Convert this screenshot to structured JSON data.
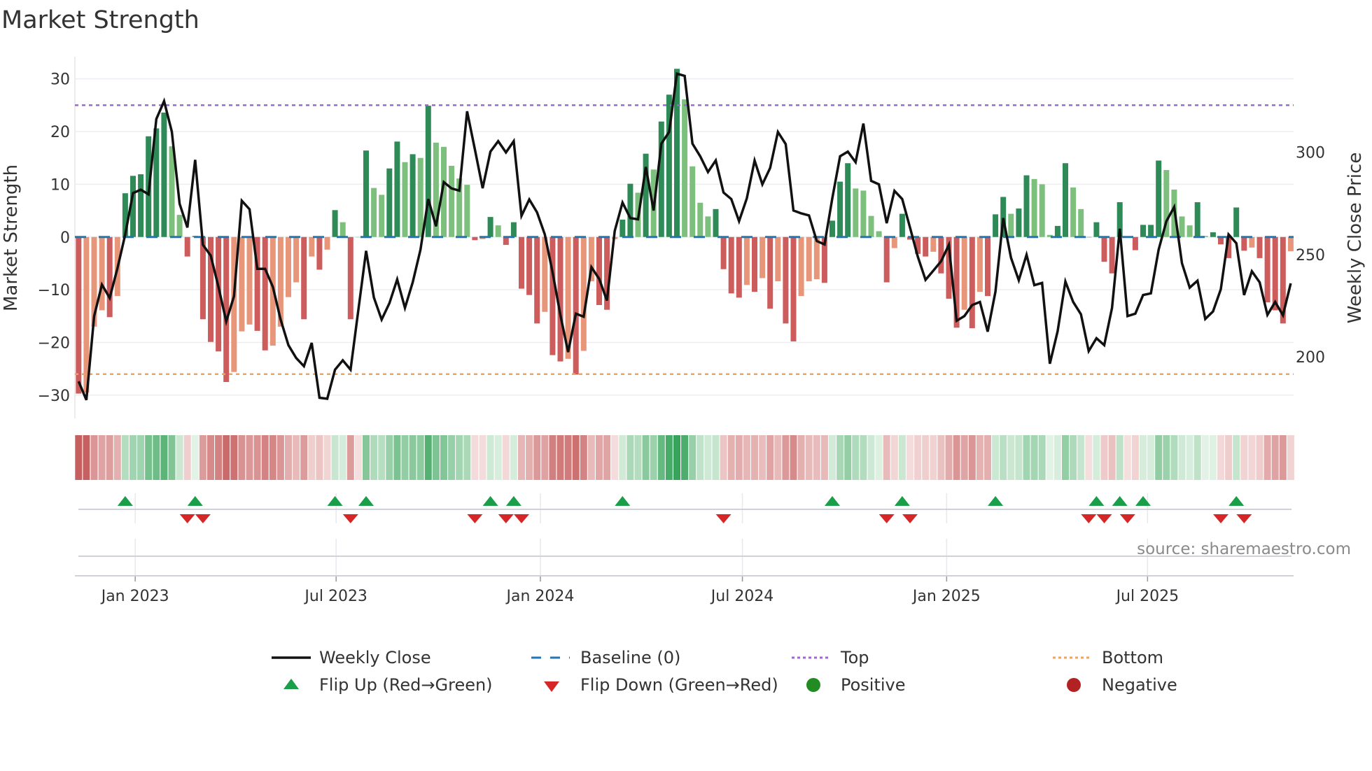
{
  "title": "Market Strength",
  "source": "source: sharemaestro.com",
  "legend": {
    "weekly_close": "Weekly Close",
    "baseline": "Baseline (0)",
    "top": "Top",
    "bottom": "Bottom",
    "flip_up": "Flip Up (Red→Green)",
    "flip_down": "Flip Down (Green→Red)",
    "positive": "Positive",
    "negative": "Negative"
  },
  "chart_data": {
    "type": "bar+line",
    "title": "Market Strength",
    "ylabel": "Market Strength",
    "y2label": "Weekly Close Price",
    "ylim": [
      -34.4,
      34.2
    ],
    "y2lim": [
      169.9,
      346.7
    ],
    "yticks": [
      -30,
      -20,
      -10,
      0,
      10,
      20,
      30
    ],
    "ytick_labels": [
      "−30",
      "−20",
      "−10",
      "0",
      "10",
      "20",
      "30"
    ],
    "y2ticks": [
      200,
      250,
      300
    ],
    "y2tick_labels": [
      "200",
      "250",
      "300"
    ],
    "xticks": [
      {
        "date": "2023-01-01",
        "label": "Jan 2023"
      },
      {
        "date": "2023-07-01",
        "label": "Jul 2023"
      },
      {
        "date": "2024-01-01",
        "label": "Jan 2024"
      },
      {
        "date": "2024-07-01",
        "label": "Jul 2024"
      },
      {
        "date": "2025-01-01",
        "label": "Jan 2025"
      },
      {
        "date": "2025-07-01",
        "label": "Jul 2025"
      }
    ],
    "start_date": "2022-11-11",
    "frequency": "weekly",
    "top_threshold": 25,
    "bottom_threshold": -26,
    "baseline": 0,
    "legend_position": "bottom",
    "colors": {
      "pos_strong": "#2e8b57",
      "pos_weak": "#7dbf7d",
      "neg_strong": "#cd5c5c",
      "neg_weak": "#e8967a",
      "close": "#111111",
      "baseline": "#1f77b4",
      "top": "#a066d8",
      "bottom": "#f0a35a",
      "flip_up": "#1a9e4a",
      "flip_down": "#d62728",
      "positive": "#228b22",
      "negative": "#b22222"
    },
    "strength": [
      -29.7,
      -29.5,
      -17,
      -13.9,
      -15.2,
      -11.2,
      8.3,
      11.6,
      11.9,
      19.1,
      20.6,
      23.6,
      17.2,
      4.2,
      -3.7,
      0.2,
      -15.6,
      -19.9,
      -21.7,
      -27.5,
      -25.6,
      -17.9,
      -16.6,
      -17.8,
      -21.5,
      -20.6,
      -17,
      -11.4,
      -8.6,
      -15.6,
      -3.7,
      -6.2,
      -2.4,
      5.1,
      2.8,
      -15.6,
      0,
      16.4,
      9.3,
      8.0,
      13,
      18.1,
      14.2,
      15.7,
      15,
      24.9,
      17.9,
      17.1,
      13.5,
      11.1,
      9.9,
      -0.6,
      -0.4,
      3.8,
      2.2,
      -1.5,
      2.8,
      -9.8,
      -11,
      -16.4,
      -14.2,
      -22.4,
      -23.6,
      -23.1,
      -26.1,
      -21.6,
      -8.4,
      -12.9,
      -13.8,
      -0.4,
      3.3,
      10.1,
      8.4,
      15.8,
      12.8,
      21.9,
      27,
      31.9,
      26.1,
      13.4,
      6.5,
      3.9,
      5.3,
      -6.1,
      -10.7,
      -11.5,
      -9.1,
      -10.4,
      -7.8,
      -13.6,
      -8.4,
      -16.4,
      -19.8,
      -11.2,
      -8.4,
      -8.0,
      -8.7,
      3.1,
      10.5,
      14,
      9.2,
      8.8,
      4,
      1.1,
      -8.6,
      -2.1,
      4.4,
      -0.5,
      -3.2,
      -3.7,
      -2.8,
      -6.9,
      -11.7,
      -17.2,
      -13.8,
      -17.3,
      -10.4,
      -11.2,
      4.3,
      7.6,
      4.4,
      5.4,
      11.7,
      11,
      10,
      0.4,
      2.1,
      14,
      9.4,
      5.3,
      0,
      2.8,
      -4.7,
      -6.9,
      6.6,
      -0.1,
      -2.5,
      2.3,
      2.3,
      14.5,
      12.7,
      9,
      3.9,
      2.2,
      6.6,
      0.2,
      0.9,
      -1.4,
      -4,
      5.6,
      -2.6,
      -2,
      -4,
      -12.4,
      -13.9,
      -16.4,
      -2.7
    ],
    "close": [
      188,
      178.9,
      219.9,
      235.3,
      228.8,
      243.3,
      259.8,
      280,
      281.7,
      279.4,
      316.2,
      325,
      310,
      274.8,
      263.2,
      296.3,
      254.7,
      249.5,
      234.2,
      217.3,
      229.6,
      276.3,
      272.1,
      243,
      243,
      234.2,
      218.2,
      205.7,
      199.4,
      195.4,
      206.8,
      180,
      179.5,
      193.7,
      198.3,
      193.7,
      222.8,
      251.8,
      229,
      218.2,
      226.2,
      237.8,
      223.9,
      236.4,
      252.4,
      277.1,
      263.8,
      285.4,
      282.3,
      281.2,
      320,
      301.4,
      282.4,
      300.3,
      305.4,
      299.9,
      305.4,
      268.9,
      276.9,
      270.6,
      259.8,
      241.3,
      220.5,
      202.3,
      221.1,
      219.6,
      243.8,
      238.1,
      227.5,
      261.5,
      275.4,
      267.8,
      267.2,
      292.8,
      271.5,
      304.2,
      309.9,
      338.4,
      337.3,
      304.2,
      298,
      290.3,
      296,
      280.3,
      277.1,
      266.3,
      277.5,
      295.9,
      284.3,
      292.3,
      309.9,
      304,
      271.5,
      270.1,
      269.1,
      256.6,
      254.9,
      277.5,
      298,
      300.3,
      295.1,
      314,
      286,
      284.3,
      265.3,
      281.1,
      277.1,
      263.2,
      249,
      237.6,
      242.1,
      246.7,
      254.7,
      217.6,
      219.9,
      225.3,
      226.8,
      212.3,
      231.9,
      267.8,
      248.4,
      237.4,
      249.9,
      235,
      236.1,
      196.6,
      212.5,
      236.8,
      226.8,
      220.8,
      202.8,
      209.1,
      205.7,
      223.9,
      262.6,
      219.9,
      221.1,
      230.2,
      231,
      252.4,
      266.3,
      273.2,
      245.8,
      233.8,
      237.2,
      218.5,
      222.2,
      233,
      259.8,
      255.5,
      230.2,
      241.8,
      236.4,
      220.5,
      226.8,
      220.3,
      235.9
    ]
  }
}
